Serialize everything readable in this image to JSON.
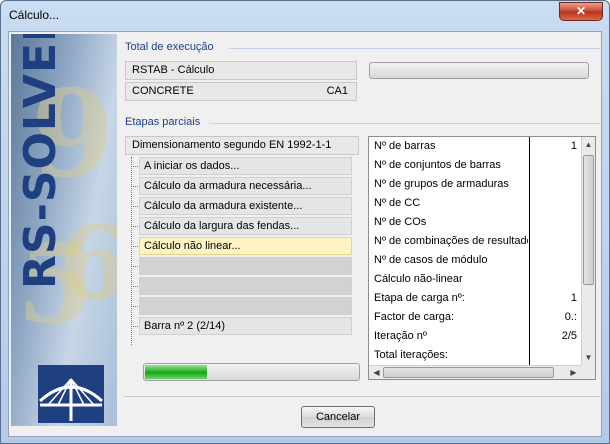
{
  "window": {
    "title": "Cálculo...",
    "close_glyph": "✕"
  },
  "banner": {
    "product": "RS-SOLVER",
    "logo_icon": "bridge-logo-icon"
  },
  "total": {
    "group_title": "Total de execução",
    "program": "RSTAB - Cálculo",
    "module": "CONCRETE",
    "case": "CA1",
    "progress_fraction": 0.0
  },
  "partial": {
    "group_title": "Etapas parciais",
    "heading": "Dimensionamento segundo EN 1992-1-1",
    "steps": [
      {
        "label": "A iniciar os dados...",
        "state": "done"
      },
      {
        "label": "Cálculo da armadura necessária...",
        "state": "done"
      },
      {
        "label": "Cálculo da armadura existente...",
        "state": "done"
      },
      {
        "label": "Cálculo da largura das fendas...",
        "state": "done"
      },
      {
        "label": "Cálculo não linear...",
        "state": "active"
      },
      {
        "label": "",
        "state": "empty"
      },
      {
        "label": "",
        "state": "empty"
      },
      {
        "label": "",
        "state": "empty"
      }
    ],
    "footer": "Barra nº 2  (2/14)",
    "progress_fraction": 0.29
  },
  "info": {
    "rows": [
      {
        "label": "Nº de barras",
        "value": "1"
      },
      {
        "label": "Nº de conjuntos de barras",
        "value": ""
      },
      {
        "label": "Nº de grupos de armaduras",
        "value": ""
      },
      {
        "label": "Nº de CC",
        "value": ""
      },
      {
        "label": "Nº de COs",
        "value": ""
      },
      {
        "label": "Nº de combinações de resultados",
        "value": ""
      },
      {
        "label": "Nº de casos de módulo",
        "value": ""
      },
      {
        "label": "Cálculo não-linear",
        "value": ""
      },
      {
        "label": "Etapa de carga nº:",
        "value": "1"
      },
      {
        "label": "Factor de carga:",
        "value": "0.:"
      },
      {
        "label": "Iteração nº",
        "value": "2/5"
      },
      {
        "label": "Total iterações:",
        "value": ""
      }
    ]
  },
  "buttons": {
    "cancel": "Cancelar"
  }
}
